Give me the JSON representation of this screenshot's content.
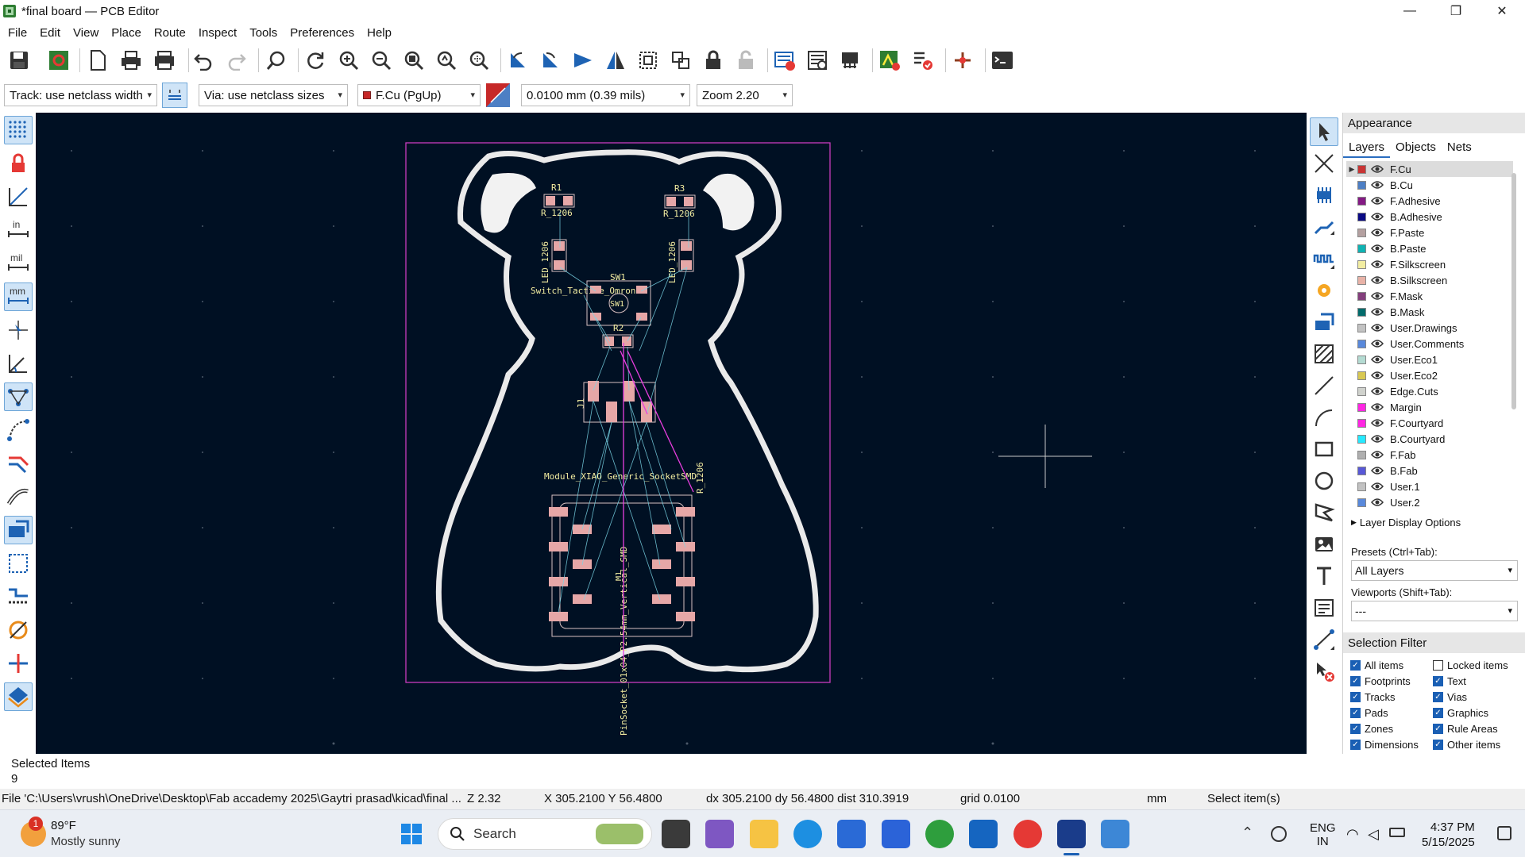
{
  "window": {
    "title": "*final board — PCB Editor",
    "controls": {
      "minimize": "—",
      "maximize": "❐",
      "close": "✕"
    }
  },
  "menu": [
    "File",
    "Edit",
    "View",
    "Place",
    "Route",
    "Inspect",
    "Tools",
    "Preferences",
    "Help"
  ],
  "toolbar2": {
    "track": "Track: use netclass width",
    "via": "Via: use netclass sizes",
    "layer": "F.Cu (PgUp)",
    "grid": "0.0100 mm (0.39 mils)",
    "zoom": "Zoom 2.20"
  },
  "left_tools": {
    "units_in": "in",
    "units_mil": "mil",
    "units_mm": "mm"
  },
  "board_text": {
    "r1": "R1",
    "r1_value": "R_1206",
    "r3": "R3",
    "r3_value": "R_1206",
    "led_left": "LED_1206",
    "led_right": "LED_1206",
    "sw1": "SW1",
    "sw1_value": "Switch_Tactile_Omron",
    "sw1_inner": "SW1",
    "r2": "R2",
    "j1": "J1",
    "module": "Module_XIAO_Generic_SocketSMD",
    "r_bottom": "R_1206",
    "pinsocket": "PinSocket_01x04_P2.54mm_Vertical_SMD",
    "mid_ref": "M1"
  },
  "appearance": {
    "title": "Appearance",
    "tabs": [
      "Layers",
      "Objects",
      "Nets"
    ],
    "layers": [
      {
        "name": "F.Cu",
        "color": "#c83434"
      },
      {
        "name": "B.Cu",
        "color": "#4d7fc4"
      },
      {
        "name": "F.Adhesive",
        "color": "#841a84"
      },
      {
        "name": "B.Adhesive",
        "color": "#0a0a84"
      },
      {
        "name": "F.Paste",
        "color": "#b4a0a0"
      },
      {
        "name": "B.Paste",
        "color": "#0fb3b3"
      },
      {
        "name": "F.Silkscreen",
        "color": "#f2eda1"
      },
      {
        "name": "B.Silkscreen",
        "color": "#e8b2a7"
      },
      {
        "name": "F.Mask",
        "color": "#843f7d"
      },
      {
        "name": "B.Mask",
        "color": "#026b6b"
      },
      {
        "name": "User.Drawings",
        "color": "#c2c2c2"
      },
      {
        "name": "User.Comments",
        "color": "#5989db"
      },
      {
        "name": "User.Eco1",
        "color": "#b4dbd2"
      },
      {
        "name": "User.Eco2",
        "color": "#d8c852"
      },
      {
        "name": "Edge.Cuts",
        "color": "#d0d2cd"
      },
      {
        "name": "Margin",
        "color": "#ff26e2"
      },
      {
        "name": "F.Courtyard",
        "color": "#ff26e2"
      },
      {
        "name": "B.Courtyard",
        "color": "#26e9ff"
      },
      {
        "name": "F.Fab",
        "color": "#afafaf"
      },
      {
        "name": "B.Fab",
        "color": "#5858d7"
      },
      {
        "name": "User.1",
        "color": "#c2c2c2"
      },
      {
        "name": "User.2",
        "color": "#5989db"
      }
    ],
    "layer_display_options": "Layer Display Options",
    "presets_label": "Presets (Ctrl+Tab):",
    "presets_value": "All Layers",
    "viewports_label": "Viewports (Shift+Tab):",
    "viewports_value": "---"
  },
  "selection_filter": {
    "title": "Selection Filter",
    "items": [
      {
        "label": "All items",
        "checked": true
      },
      {
        "label": "Locked items",
        "checked": false
      },
      {
        "label": "Footprints",
        "checked": true
      },
      {
        "label": "Text",
        "checked": true
      },
      {
        "label": "Tracks",
        "checked": true
      },
      {
        "label": "Vias",
        "checked": true
      },
      {
        "label": "Pads",
        "checked": true
      },
      {
        "label": "Graphics",
        "checked": true
      },
      {
        "label": "Zones",
        "checked": true
      },
      {
        "label": "Rule Areas",
        "checked": true
      },
      {
        "label": "Dimensions",
        "checked": true
      },
      {
        "label": "Other items",
        "checked": true
      }
    ]
  },
  "message_panel": {
    "label": "Selected Items",
    "value": "9"
  },
  "status": {
    "file": "File 'C:\\Users\\vrush\\OneDrive\\Desktop\\Fab accademy 2025\\Gaytri prasad\\kicad\\final ...",
    "zoom": "Z 2.32",
    "xy": "X 305.2100  Y 56.4800",
    "delta": "dx 305.2100  dy 56.4800  dist 310.3919",
    "grid": "grid 0.0100",
    "units": "mm",
    "action": "Select item(s)"
  },
  "taskbar": {
    "weather_temp": "89°F",
    "weather_desc": "Mostly sunny",
    "weather_badge": "1",
    "search": "Search",
    "lang_line1": "ENG",
    "lang_line2": "IN",
    "time": "4:37 PM",
    "date": "5/15/2025"
  }
}
